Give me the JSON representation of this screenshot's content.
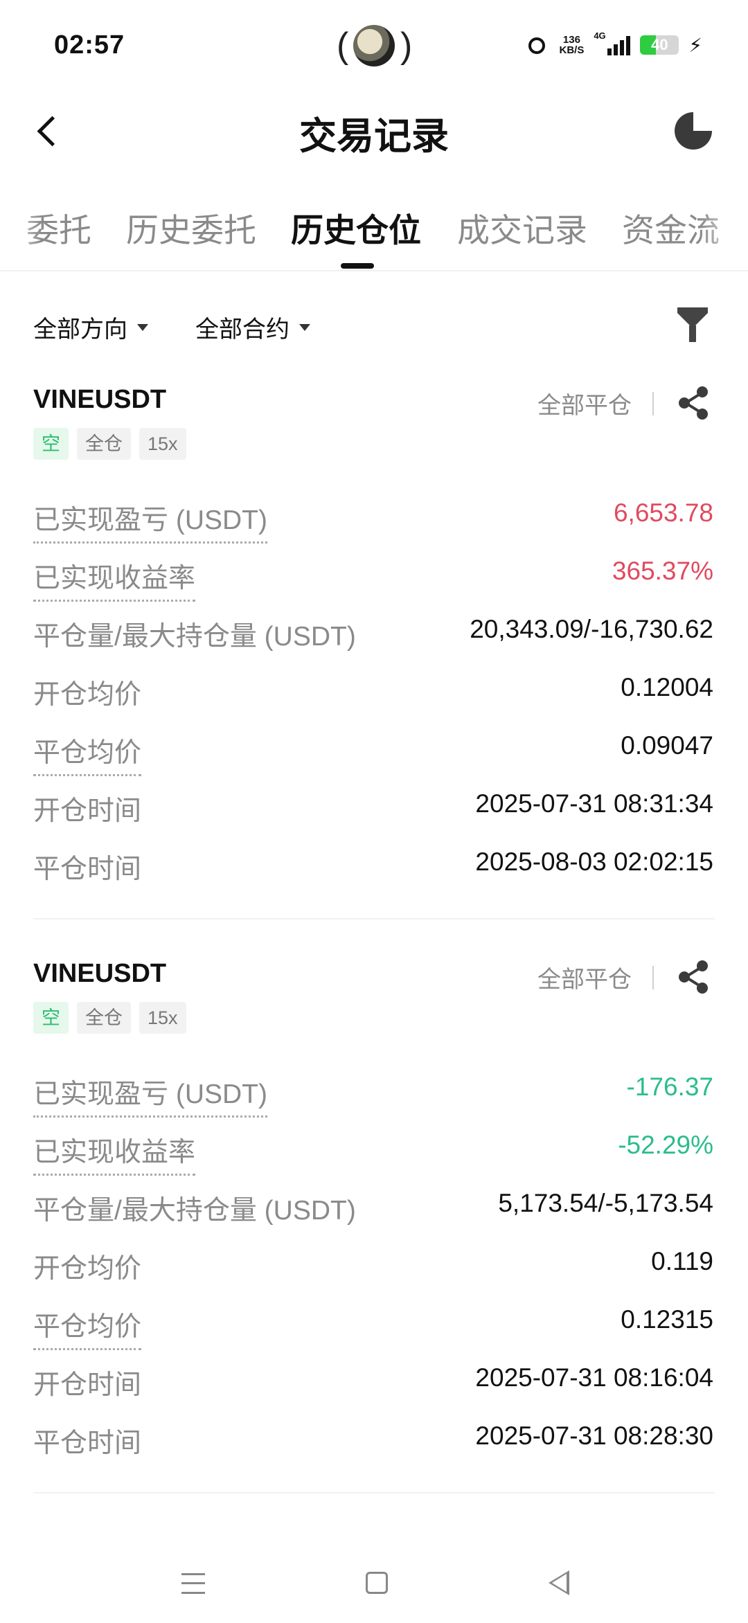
{
  "status_bar": {
    "time": "02:57",
    "net_speed_value": "136",
    "net_speed_unit": "KB/S",
    "network_type": "4G",
    "battery": "40",
    "icons": [
      "camera-icon",
      "alarm-icon",
      "signal-icon",
      "battery-icon",
      "charging-icon"
    ]
  },
  "header": {
    "title": "交易记录",
    "back_icon": "chevron-left-icon",
    "stats_icon": "pie-chart-icon"
  },
  "tabs": [
    {
      "label": "委托",
      "active": false
    },
    {
      "label": "历史委托",
      "active": false
    },
    {
      "label": "历史仓位",
      "active": true
    },
    {
      "label": "成交记录",
      "active": false
    },
    {
      "label": "资金流",
      "active": false
    }
  ],
  "filters": {
    "direction": "全部方向",
    "contract": "全部合约",
    "filter_icon": "funnel-icon"
  },
  "positions": [
    {
      "symbol": "VINEUSDT",
      "close_action": "全部平仓",
      "tags": [
        "空",
        "全仓",
        "15x"
      ],
      "rows": [
        {
          "label": "已实现盈亏 (USDT)",
          "value": "6,653.78"
        },
        {
          "label": "已实现收益率",
          "value": "365.37%"
        },
        {
          "label": "平仓量/最大持仓量 (USDT)",
          "value": "20,343.09/-16,730.62"
        },
        {
          "label": "开仓均价",
          "value": "0.12004"
        },
        {
          "label": "平仓均价",
          "value": "0.09047"
        },
        {
          "label": "开仓时间",
          "value": "2025-07-31 08:31:34"
        },
        {
          "label": "平仓时间",
          "value": "2025-08-03 02:02:15"
        }
      ]
    },
    {
      "symbol": "VINEUSDT",
      "close_action": "全部平仓",
      "tags": [
        "空",
        "全仓",
        "15x"
      ],
      "rows": [
        {
          "label": "已实现盈亏 (USDT)",
          "value": "-176.37"
        },
        {
          "label": "已实现收益率",
          "value": "-52.29%"
        },
        {
          "label": "平仓量/最大持仓量 (USDT)",
          "value": "5,173.54/-5,173.54"
        },
        {
          "label": "开仓均价",
          "value": "0.119"
        },
        {
          "label": "平仓均价",
          "value": "0.12315"
        },
        {
          "label": "开仓时间",
          "value": "2025-07-31 08:16:04"
        },
        {
          "label": "平仓时间",
          "value": "2025-07-31 08:28:30"
        }
      ]
    }
  ],
  "colors": {
    "profit": "#e04a5f",
    "loss": "#2bbd8a",
    "short_tag": "#2bbd6e"
  },
  "nav_bar": [
    "menu-icon",
    "home-icon",
    "back-icon"
  ]
}
